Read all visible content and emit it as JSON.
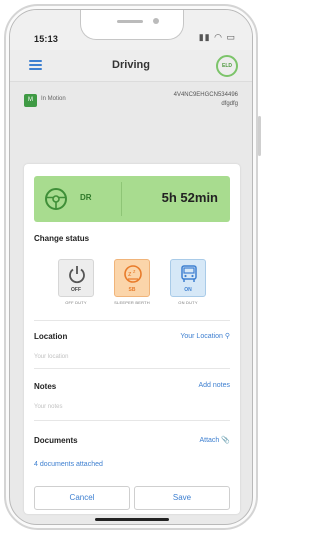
{
  "status_bar": {
    "time": "15:13",
    "icons": "▮▮ ◠ ▭"
  },
  "header": {
    "title": "Driving",
    "eld_badge": "ELD"
  },
  "motion": {
    "badge": "M",
    "label": "In Motion",
    "vin": "4V4NC9EHGCN534496",
    "name": "dfgdfg"
  },
  "status_card": {
    "code": "DR",
    "duration": "5h 52min"
  },
  "change_status": {
    "label": "Change status",
    "options": [
      {
        "code": "OFF",
        "caption": "OFF DUTY"
      },
      {
        "code": "SB",
        "caption": "SLEEPER BERTH"
      },
      {
        "code": "ON",
        "caption": "ON DUTY"
      }
    ]
  },
  "location": {
    "label": "Location",
    "action": "Your Location",
    "placeholder": "Your location"
  },
  "notes": {
    "label": "Notes",
    "action": "Add notes",
    "placeholder": "Your notes"
  },
  "documents": {
    "label": "Documents",
    "action": "Attach",
    "attached": "4 documents attached"
  },
  "actions": {
    "cancel": "Cancel",
    "save": "Save"
  },
  "colors": {
    "accent": "#3d7fd0",
    "driving": "#a8dc8f",
    "sleeper": "#fbd5aa",
    "on_duty": "#d6e8f7"
  }
}
